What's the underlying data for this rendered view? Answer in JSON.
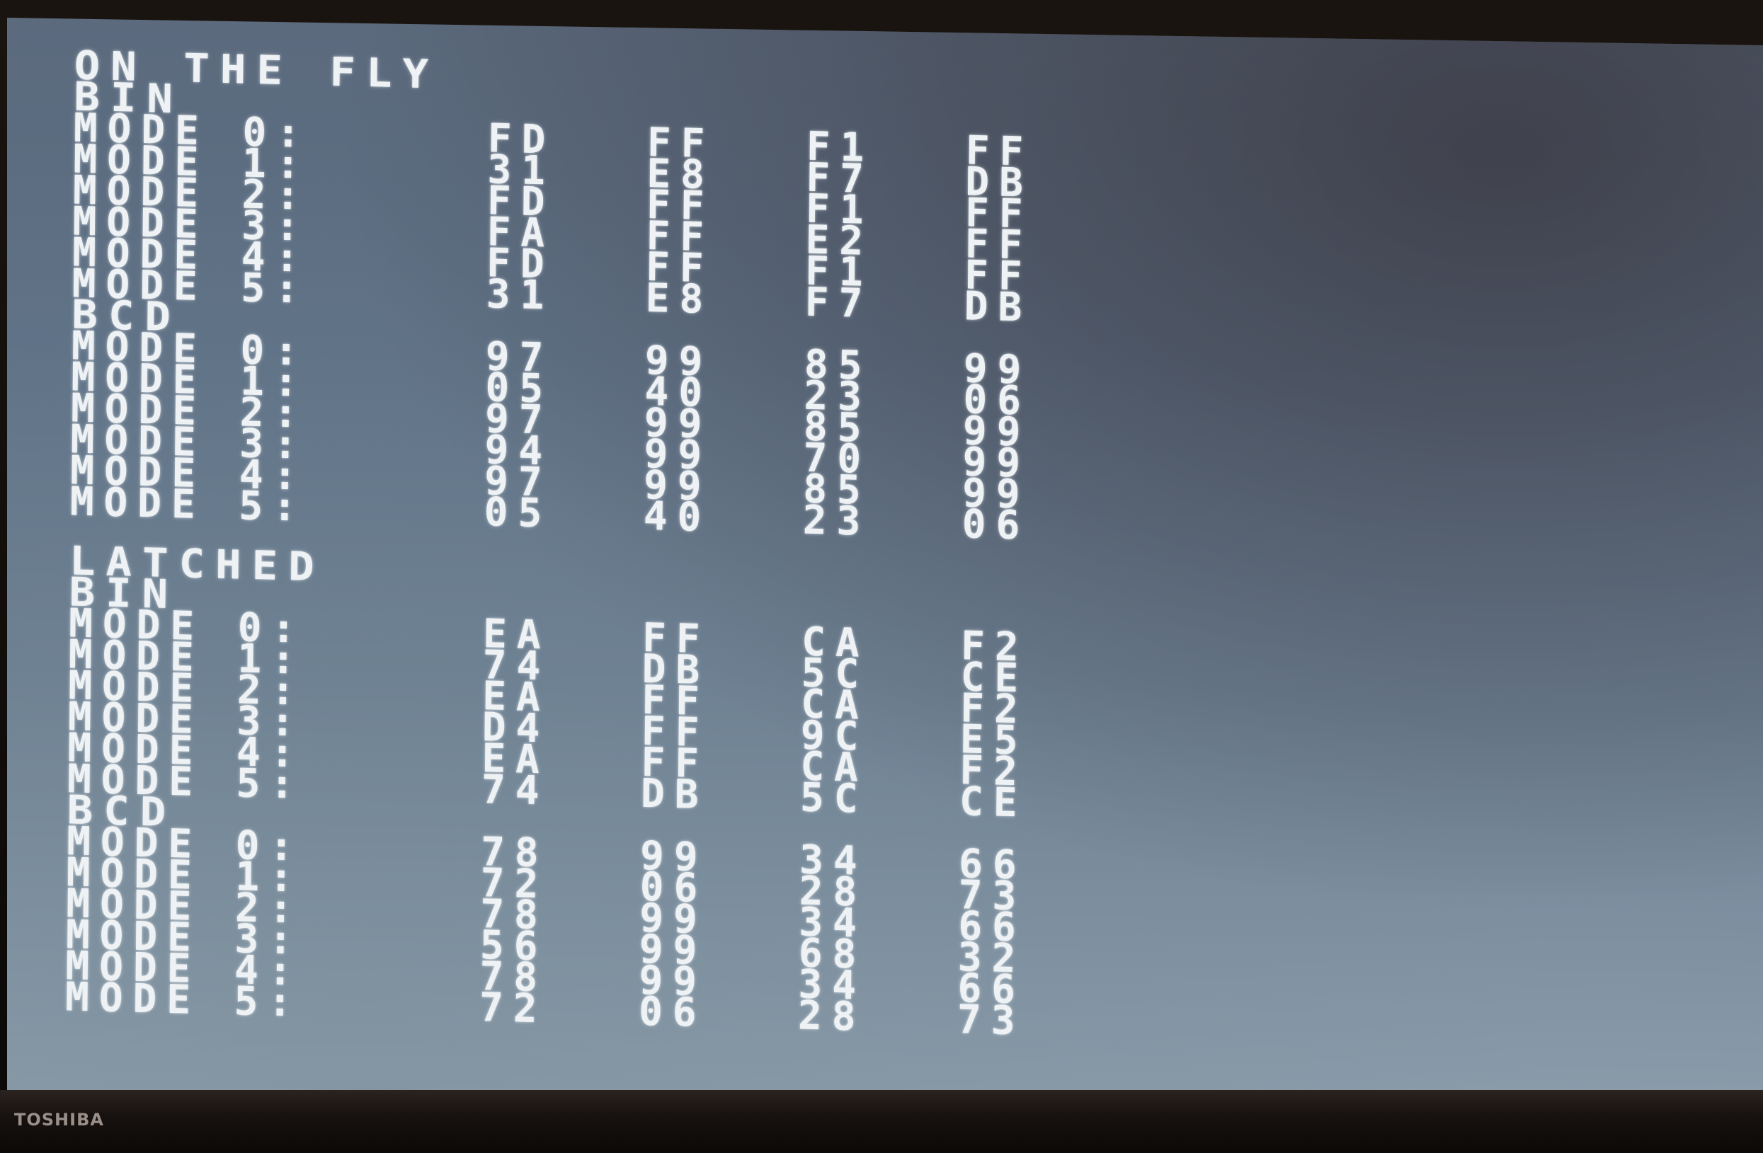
{
  "screen": {
    "sections": [
      {
        "title": "ON THE FLY",
        "groups": [
          {
            "name": "BIN",
            "rows": [
              {
                "label": "MODE 0:",
                "values": [
                  "FD",
                  "FF",
                  "F1",
                  "FF"
                ]
              },
              {
                "label": "MODE 1:",
                "values": [
                  "31",
                  "E8",
                  "F7",
                  "DB"
                ]
              },
              {
                "label": "MODE 2:",
                "values": [
                  "FD",
                  "FF",
                  "F1",
                  "FF"
                ]
              },
              {
                "label": "MODE 3:",
                "values": [
                  "FA",
                  "FF",
                  "E2",
                  "FF"
                ]
              },
              {
                "label": "MODE 4:",
                "values": [
                  "FD",
                  "FF",
                  "F1",
                  "FF"
                ]
              },
              {
                "label": "MODE 5:",
                "values": [
                  "31",
                  "E8",
                  "F7",
                  "DB"
                ]
              }
            ]
          },
          {
            "name": "BCD",
            "rows": [
              {
                "label": "MODE 0:",
                "values": [
                  "97",
                  "99",
                  "85",
                  "99"
                ]
              },
              {
                "label": "MODE 1:",
                "values": [
                  "05",
                  "40",
                  "23",
                  "06"
                ]
              },
              {
                "label": "MODE 2:",
                "values": [
                  "97",
                  "99",
                  "85",
                  "99"
                ]
              },
              {
                "label": "MODE 3:",
                "values": [
                  "94",
                  "99",
                  "70",
                  "99"
                ]
              },
              {
                "label": "MODE 4:",
                "values": [
                  "97",
                  "99",
                  "85",
                  "99"
                ]
              },
              {
                "label": "MODE 5:",
                "values": [
                  "05",
                  "40",
                  "23",
                  "06"
                ]
              }
            ]
          }
        ]
      },
      {
        "title": "LATCHED",
        "groups": [
          {
            "name": "BIN",
            "rows": [
              {
                "label": "MODE 0:",
                "values": [
                  "EA",
                  "FF",
                  "CA",
                  "F2"
                ]
              },
              {
                "label": "MODE 1:",
                "values": [
                  "74",
                  "DB",
                  "5C",
                  "CE"
                ]
              },
              {
                "label": "MODE 2:",
                "values": [
                  "EA",
                  "FF",
                  "CA",
                  "F2"
                ]
              },
              {
                "label": "MODE 3:",
                "values": [
                  "D4",
                  "FF",
                  "9C",
                  "E5"
                ]
              },
              {
                "label": "MODE 4:",
                "values": [
                  "EA",
                  "FF",
                  "CA",
                  "F2"
                ]
              },
              {
                "label": "MODE 5:",
                "values": [
                  "74",
                  "DB",
                  "5C",
                  "CE"
                ]
              }
            ]
          },
          {
            "name": "BCD",
            "rows": [
              {
                "label": "MODE 0:",
                "values": [
                  "78",
                  "99",
                  "34",
                  "66"
                ]
              },
              {
                "label": "MODE 1:",
                "values": [
                  "72",
                  "06",
                  "28",
                  "73"
                ]
              },
              {
                "label": "MODE 2:",
                "values": [
                  "78",
                  "99",
                  "34",
                  "66"
                ]
              },
              {
                "label": "MODE 3:",
                "values": [
                  "56",
                  "99",
                  "68",
                  "32"
                ]
              },
              {
                "label": "MODE 4:",
                "values": [
                  "78",
                  "99",
                  "34",
                  "66"
                ]
              },
              {
                "label": "MODE 5:",
                "values": [
                  "72",
                  "06",
                  "28",
                  "73"
                ]
              }
            ]
          }
        ]
      }
    ]
  },
  "bezel": {
    "brand": "TOSHIBA"
  }
}
